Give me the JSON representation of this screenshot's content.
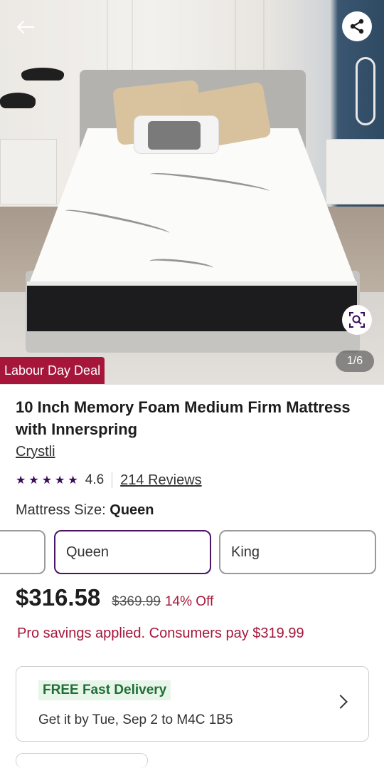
{
  "hero": {
    "image_alt": "Mattress product photo",
    "counter": "1/6",
    "deal_badge": "Labour Day Deal",
    "icons": {
      "back": "arrow-left-icon",
      "share": "share-icon",
      "visual_search": "image-search-icon"
    }
  },
  "product": {
    "title": "10 Inch Memory Foam Medium Firm Mattress with Innerspring",
    "brand": "Crystli",
    "rating": "4.6",
    "stars": "★★★★★",
    "reviews": "214 Reviews"
  },
  "size": {
    "label": "Mattress Size:",
    "selected": "Queen",
    "options": [
      "",
      "Queen",
      "King"
    ]
  },
  "pricing": {
    "price": "$316.58",
    "original": "$369.99",
    "discount": "14% Off",
    "pro_note": "Pro savings applied. Consumers pay $319.99",
    "accent_color": "#a6163b"
  },
  "delivery": {
    "badge": "FREE Fast Delivery",
    "estimate": "Get it by Tue, Sep 2 to M4C 1B5"
  }
}
